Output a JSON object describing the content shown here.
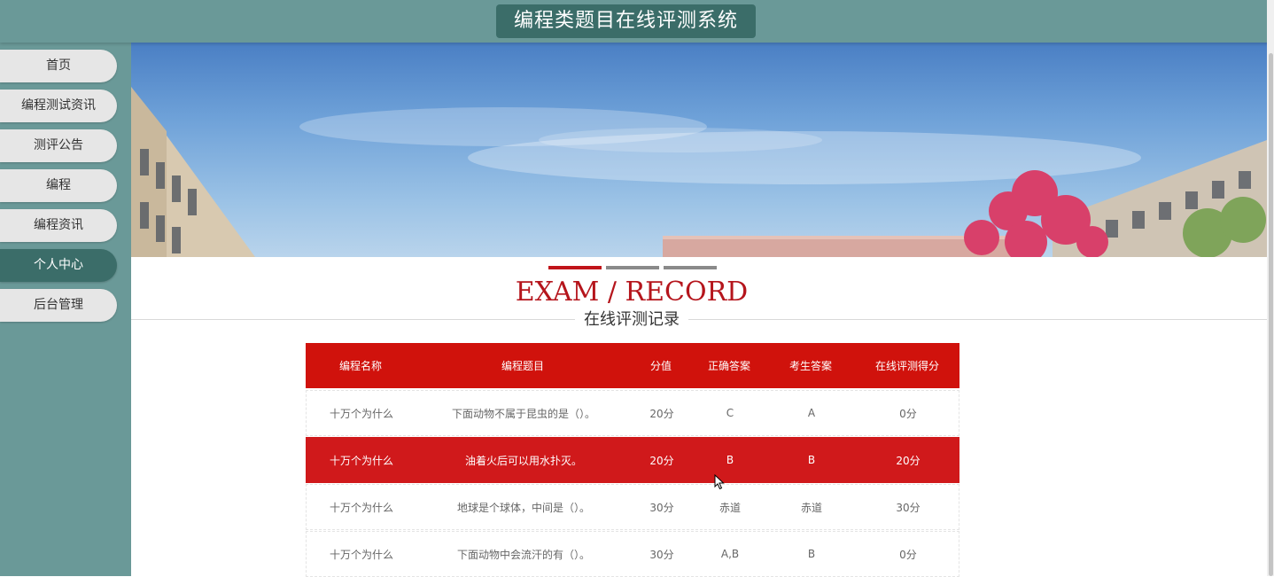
{
  "header": {
    "title": "编程类题目在线评测系统"
  },
  "sidebar": {
    "items": [
      {
        "label": "首页",
        "active": false
      },
      {
        "label": "编程测试资讯",
        "active": false
      },
      {
        "label": "测评公告",
        "active": false
      },
      {
        "label": "编程",
        "active": false
      },
      {
        "label": "编程资讯",
        "active": false
      },
      {
        "label": "个人中心",
        "active": true
      },
      {
        "label": "后台管理",
        "active": false
      }
    ]
  },
  "carousel": {
    "slide_count": 3,
    "active_index": 0
  },
  "section": {
    "title_en": "EXAM / RECORD",
    "title_cn": "在线评测记录"
  },
  "table": {
    "columns": [
      "编程名称",
      "编程题目",
      "分值",
      "正确答案",
      "考生答案",
      "在线评测得分"
    ],
    "rows": [
      [
        "十万个为什么",
        "下面动物不属于昆虫的是（）。",
        "20分",
        "C",
        "A",
        "0分"
      ],
      [
        "十万个为什么",
        "油着火后可以用水扑灭。",
        "20分",
        "B",
        "B",
        "20分"
      ],
      [
        "十万个为什么",
        "地球是个球体，中间是（）。",
        "30分",
        "赤道",
        "赤道",
        "30分"
      ],
      [
        "十万个为什么",
        "下面动物中会流汗的有（）。",
        "30分",
        "A,B",
        "B",
        "0分"
      ]
    ],
    "highlighted_row": 1
  },
  "colors": {
    "teal": "#6a9998",
    "dark_teal": "#3b6d69",
    "red": "#d0120c",
    "nav_bg": "#e6e6e6"
  }
}
